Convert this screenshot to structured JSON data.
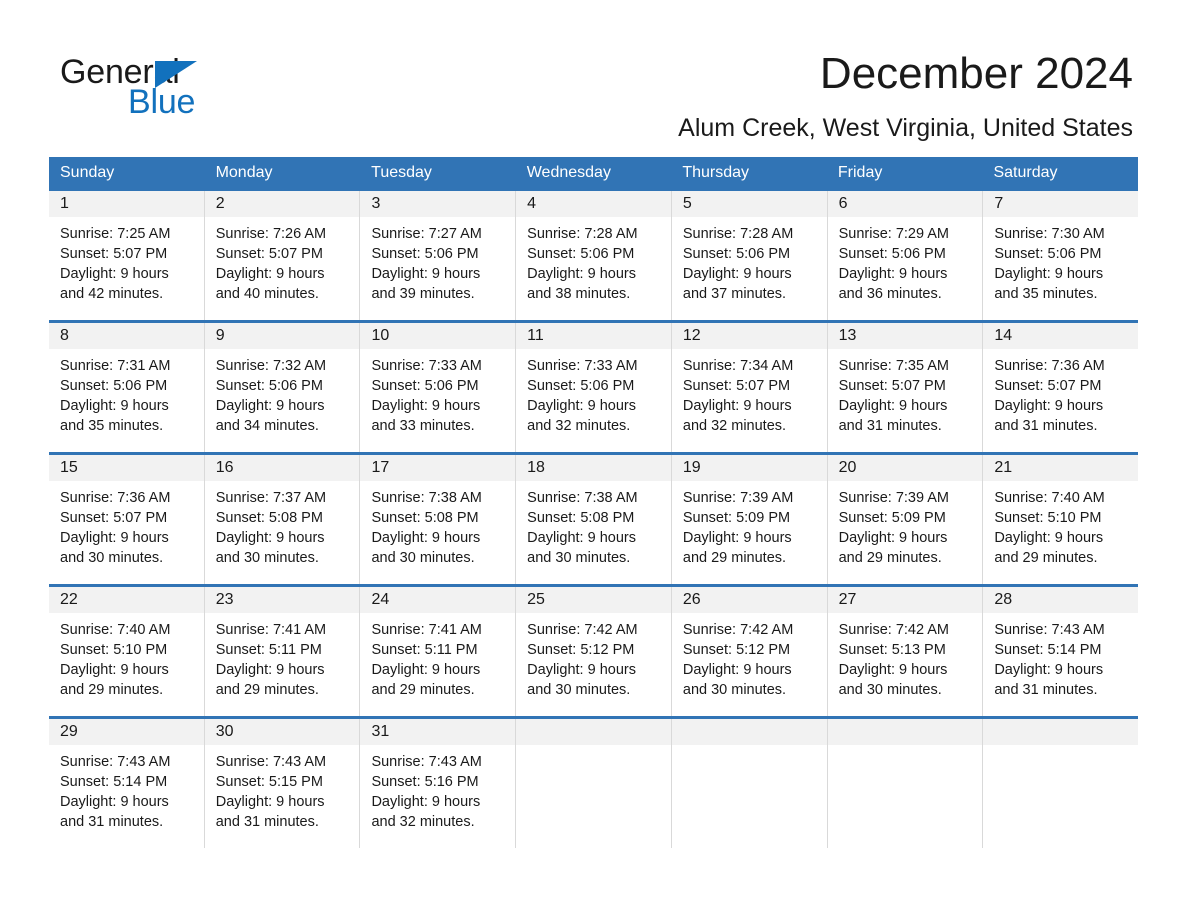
{
  "brand": {
    "logo_text_primary": "General",
    "logo_text_secondary": "Blue",
    "logo_icon": "blue-triangle-icon",
    "accent_color": "#3174b5",
    "logo_blue": "#1271bd"
  },
  "header": {
    "title": "December 2024",
    "subtitle": "Alum Creek, West Virginia, United States"
  },
  "calendar": {
    "weekdays": [
      "Sunday",
      "Monday",
      "Tuesday",
      "Wednesday",
      "Thursday",
      "Friday",
      "Saturday"
    ],
    "weeks": [
      [
        {
          "day": "1",
          "sunrise": "Sunrise: 7:25 AM",
          "sunset": "Sunset: 5:07 PM",
          "daylight_line1": "Daylight: 9 hours",
          "daylight_line2": "and 42 minutes."
        },
        {
          "day": "2",
          "sunrise": "Sunrise: 7:26 AM",
          "sunset": "Sunset: 5:07 PM",
          "daylight_line1": "Daylight: 9 hours",
          "daylight_line2": "and 40 minutes."
        },
        {
          "day": "3",
          "sunrise": "Sunrise: 7:27 AM",
          "sunset": "Sunset: 5:06 PM",
          "daylight_line1": "Daylight: 9 hours",
          "daylight_line2": "and 39 minutes."
        },
        {
          "day": "4",
          "sunrise": "Sunrise: 7:28 AM",
          "sunset": "Sunset: 5:06 PM",
          "daylight_line1": "Daylight: 9 hours",
          "daylight_line2": "and 38 minutes."
        },
        {
          "day": "5",
          "sunrise": "Sunrise: 7:28 AM",
          "sunset": "Sunset: 5:06 PM",
          "daylight_line1": "Daylight: 9 hours",
          "daylight_line2": "and 37 minutes."
        },
        {
          "day": "6",
          "sunrise": "Sunrise: 7:29 AM",
          "sunset": "Sunset: 5:06 PM",
          "daylight_line1": "Daylight: 9 hours",
          "daylight_line2": "and 36 minutes."
        },
        {
          "day": "7",
          "sunrise": "Sunrise: 7:30 AM",
          "sunset": "Sunset: 5:06 PM",
          "daylight_line1": "Daylight: 9 hours",
          "daylight_line2": "and 35 minutes."
        }
      ],
      [
        {
          "day": "8",
          "sunrise": "Sunrise: 7:31 AM",
          "sunset": "Sunset: 5:06 PM",
          "daylight_line1": "Daylight: 9 hours",
          "daylight_line2": "and 35 minutes."
        },
        {
          "day": "9",
          "sunrise": "Sunrise: 7:32 AM",
          "sunset": "Sunset: 5:06 PM",
          "daylight_line1": "Daylight: 9 hours",
          "daylight_line2": "and 34 minutes."
        },
        {
          "day": "10",
          "sunrise": "Sunrise: 7:33 AM",
          "sunset": "Sunset: 5:06 PM",
          "daylight_line1": "Daylight: 9 hours",
          "daylight_line2": "and 33 minutes."
        },
        {
          "day": "11",
          "sunrise": "Sunrise: 7:33 AM",
          "sunset": "Sunset: 5:06 PM",
          "daylight_line1": "Daylight: 9 hours",
          "daylight_line2": "and 32 minutes."
        },
        {
          "day": "12",
          "sunrise": "Sunrise: 7:34 AM",
          "sunset": "Sunset: 5:07 PM",
          "daylight_line1": "Daylight: 9 hours",
          "daylight_line2": "and 32 minutes."
        },
        {
          "day": "13",
          "sunrise": "Sunrise: 7:35 AM",
          "sunset": "Sunset: 5:07 PM",
          "daylight_line1": "Daylight: 9 hours",
          "daylight_line2": "and 31 minutes."
        },
        {
          "day": "14",
          "sunrise": "Sunrise: 7:36 AM",
          "sunset": "Sunset: 5:07 PM",
          "daylight_line1": "Daylight: 9 hours",
          "daylight_line2": "and 31 minutes."
        }
      ],
      [
        {
          "day": "15",
          "sunrise": "Sunrise: 7:36 AM",
          "sunset": "Sunset: 5:07 PM",
          "daylight_line1": "Daylight: 9 hours",
          "daylight_line2": "and 30 minutes."
        },
        {
          "day": "16",
          "sunrise": "Sunrise: 7:37 AM",
          "sunset": "Sunset: 5:08 PM",
          "daylight_line1": "Daylight: 9 hours",
          "daylight_line2": "and 30 minutes."
        },
        {
          "day": "17",
          "sunrise": "Sunrise: 7:38 AM",
          "sunset": "Sunset: 5:08 PM",
          "daylight_line1": "Daylight: 9 hours",
          "daylight_line2": "and 30 minutes."
        },
        {
          "day": "18",
          "sunrise": "Sunrise: 7:38 AM",
          "sunset": "Sunset: 5:08 PM",
          "daylight_line1": "Daylight: 9 hours",
          "daylight_line2": "and 30 minutes."
        },
        {
          "day": "19",
          "sunrise": "Sunrise: 7:39 AM",
          "sunset": "Sunset: 5:09 PM",
          "daylight_line1": "Daylight: 9 hours",
          "daylight_line2": "and 29 minutes."
        },
        {
          "day": "20",
          "sunrise": "Sunrise: 7:39 AM",
          "sunset": "Sunset: 5:09 PM",
          "daylight_line1": "Daylight: 9 hours",
          "daylight_line2": "and 29 minutes."
        },
        {
          "day": "21",
          "sunrise": "Sunrise: 7:40 AM",
          "sunset": "Sunset: 5:10 PM",
          "daylight_line1": "Daylight: 9 hours",
          "daylight_line2": "and 29 minutes."
        }
      ],
      [
        {
          "day": "22",
          "sunrise": "Sunrise: 7:40 AM",
          "sunset": "Sunset: 5:10 PM",
          "daylight_line1": "Daylight: 9 hours",
          "daylight_line2": "and 29 minutes."
        },
        {
          "day": "23",
          "sunrise": "Sunrise: 7:41 AM",
          "sunset": "Sunset: 5:11 PM",
          "daylight_line1": "Daylight: 9 hours",
          "daylight_line2": "and 29 minutes."
        },
        {
          "day": "24",
          "sunrise": "Sunrise: 7:41 AM",
          "sunset": "Sunset: 5:11 PM",
          "daylight_line1": "Daylight: 9 hours",
          "daylight_line2": "and 29 minutes."
        },
        {
          "day": "25",
          "sunrise": "Sunrise: 7:42 AM",
          "sunset": "Sunset: 5:12 PM",
          "daylight_line1": "Daylight: 9 hours",
          "daylight_line2": "and 30 minutes."
        },
        {
          "day": "26",
          "sunrise": "Sunrise: 7:42 AM",
          "sunset": "Sunset: 5:12 PM",
          "daylight_line1": "Daylight: 9 hours",
          "daylight_line2": "and 30 minutes."
        },
        {
          "day": "27",
          "sunrise": "Sunrise: 7:42 AM",
          "sunset": "Sunset: 5:13 PM",
          "daylight_line1": "Daylight: 9 hours",
          "daylight_line2": "and 30 minutes."
        },
        {
          "day": "28",
          "sunrise": "Sunrise: 7:43 AM",
          "sunset": "Sunset: 5:14 PM",
          "daylight_line1": "Daylight: 9 hours",
          "daylight_line2": "and 31 minutes."
        }
      ],
      [
        {
          "day": "29",
          "sunrise": "Sunrise: 7:43 AM",
          "sunset": "Sunset: 5:14 PM",
          "daylight_line1": "Daylight: 9 hours",
          "daylight_line2": "and 31 minutes."
        },
        {
          "day": "30",
          "sunrise": "Sunrise: 7:43 AM",
          "sunset": "Sunset: 5:15 PM",
          "daylight_line1": "Daylight: 9 hours",
          "daylight_line2": "and 31 minutes."
        },
        {
          "day": "31",
          "sunrise": "Sunrise: 7:43 AM",
          "sunset": "Sunset: 5:16 PM",
          "daylight_line1": "Daylight: 9 hours",
          "daylight_line2": "and 32 minutes."
        },
        {
          "day": "",
          "sunrise": "",
          "sunset": "",
          "daylight_line1": "",
          "daylight_line2": ""
        },
        {
          "day": "",
          "sunrise": "",
          "sunset": "",
          "daylight_line1": "",
          "daylight_line2": ""
        },
        {
          "day": "",
          "sunrise": "",
          "sunset": "",
          "daylight_line1": "",
          "daylight_line2": ""
        },
        {
          "day": "",
          "sunrise": "",
          "sunset": "",
          "daylight_line1": "",
          "daylight_line2": ""
        }
      ]
    ]
  }
}
